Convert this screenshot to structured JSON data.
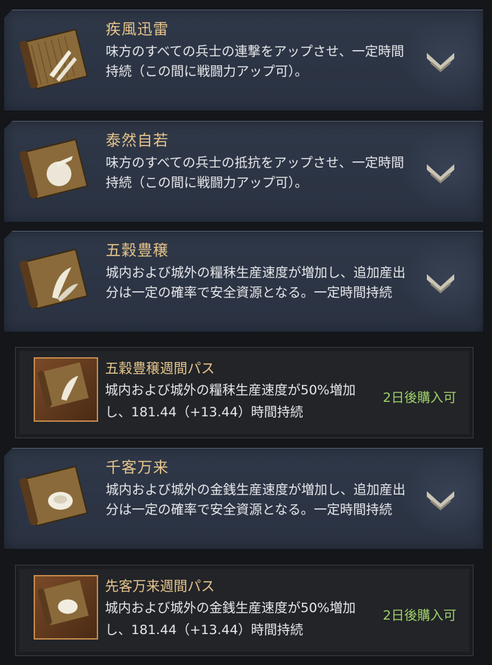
{
  "cards": [
    {
      "title": "疾風迅雷",
      "desc": "味方のすべての兵士の連撃をアップさせ、一定時間持続（この間に戦闘力アップ可）。",
      "icon": "dagger-scroll-icon"
    },
    {
      "title": "泰然自若",
      "desc": "味方のすべての兵士の抵抗をアップさせ、一定時間持続（この間に戦闘力アップ可）。",
      "icon": "shield-scroll-icon"
    },
    {
      "title": "五穀豊穣",
      "desc": "城内および城外の糧秣生産速度が増加し、追加産出分は一定の確率で安全資源となる。一定時間持続",
      "icon": "grain-scroll-icon"
    },
    {
      "title": "千客万来",
      "desc": "城内および城外の金銭生産速度が増加し、追加産出分は一定の確率で安全資源となる。一定時間持続",
      "icon": "coin-scroll-icon"
    }
  ],
  "passes": [
    {
      "title": "五穀豊穣週間パス",
      "desc": "城内および城外の糧秣生産速度が50%増加し、181.44（+13.44）時間持続",
      "status": "2日後購入可"
    },
    {
      "title": "先客万来週間パス",
      "desc": "城内および城外の金銭生産速度が50%増加し、181.44（+13.44）時間持続",
      "status": "2日後購入可"
    }
  ],
  "colors": {
    "title": "#e7c58b",
    "status": "#9ed068",
    "card_bg": "#2f3848"
  }
}
